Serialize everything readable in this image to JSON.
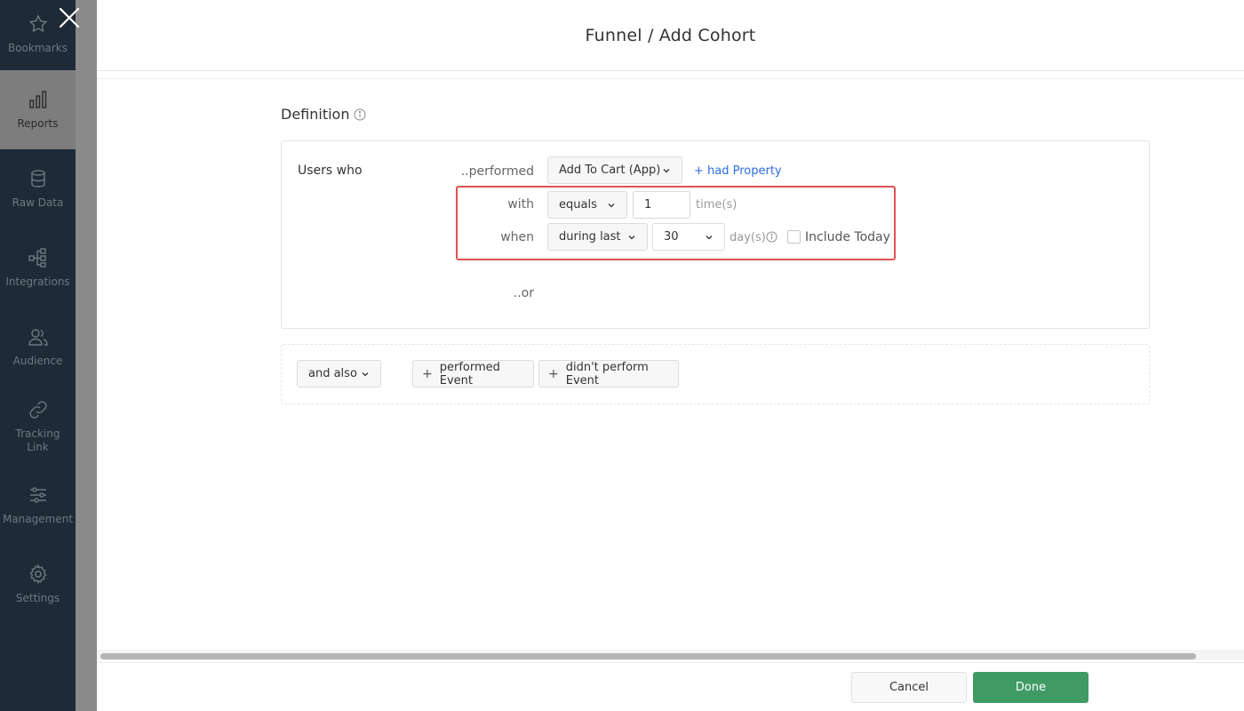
{
  "sidebar": {
    "items": [
      {
        "label": "Bookmarks",
        "icon": "star-icon"
      },
      {
        "label": "Reports",
        "icon": "bar-chart-icon"
      },
      {
        "label": "Raw Data",
        "icon": "database-icon"
      },
      {
        "label": "Integrations",
        "icon": "integrations-icon"
      },
      {
        "label": "Audience",
        "icon": "users-icon"
      },
      {
        "label": "Tracking Link",
        "icon": "link-icon"
      },
      {
        "label": "Management",
        "icon": "sliders-icon"
      },
      {
        "label": "Settings",
        "icon": "gear-icon"
      }
    ],
    "active": "Reports"
  },
  "modal": {
    "title": "Funnel / Add Cohort",
    "section_title": "Definition",
    "users_who": "Users who",
    "performed_label": "..performed",
    "event_dropdown": "Add To Cart (App)",
    "had_property_link": "+ had Property",
    "with_label": "with",
    "operator_dropdown": "equals",
    "count_value": "1",
    "count_unit": "time(s)",
    "when_label": "when",
    "time_dropdown": "during last",
    "days_dropdown": "30",
    "days_unit": "day(s)",
    "include_today_label": "Include Today",
    "include_today_checked": false,
    "or_label": "..or",
    "and_also_dropdown": "and also",
    "performed_event_button": "performed Event",
    "didnt_perform_button": "didn't perform Event",
    "cancel_button": "Cancel",
    "done_button": "Done"
  },
  "colors": {
    "sidebar_bg": "#1e2a36",
    "accent_green": "#3f9b63",
    "link_blue": "#2c6ee0",
    "highlight_red": "#e05252"
  }
}
